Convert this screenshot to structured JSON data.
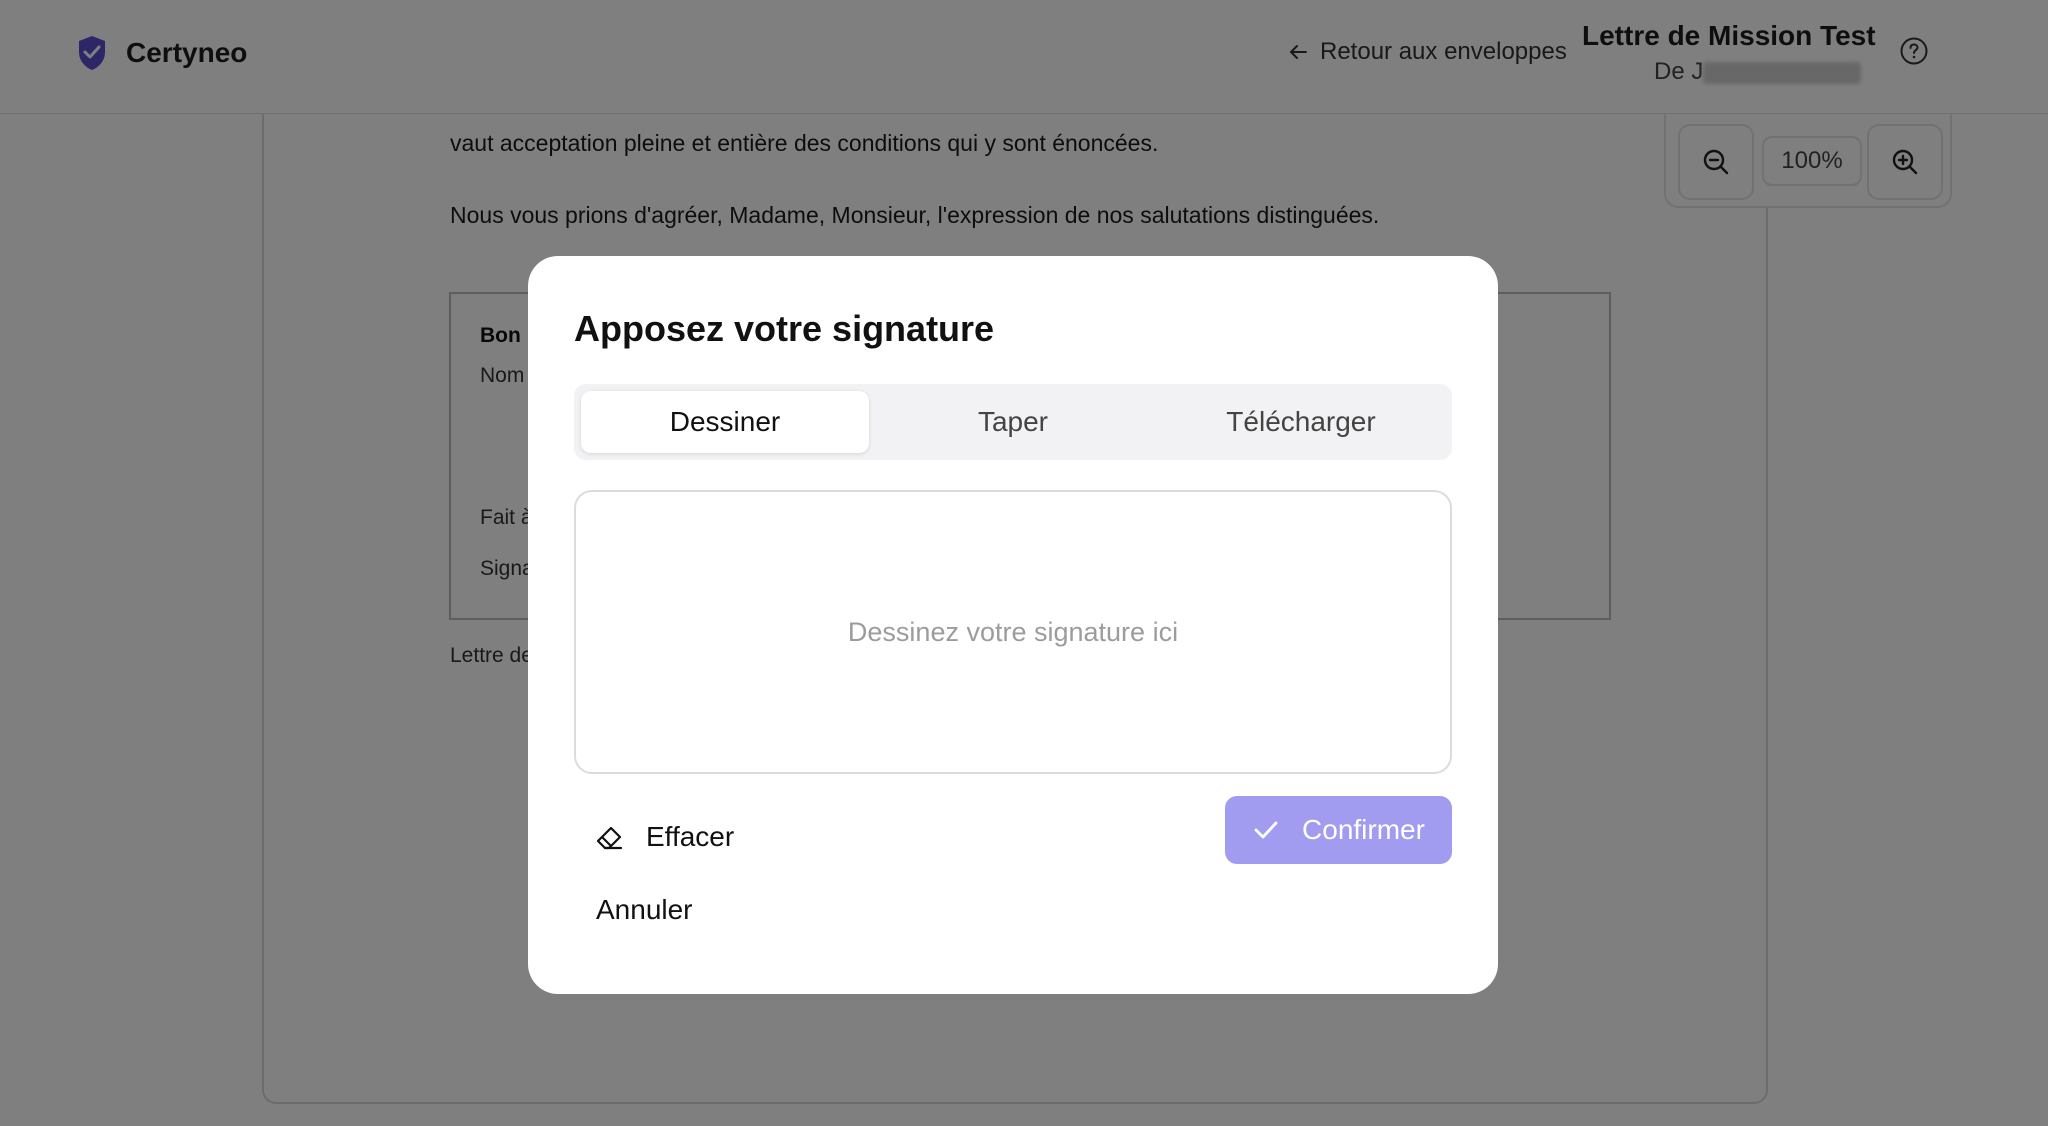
{
  "brand": {
    "name": "Certyneo",
    "logo_icon": "shield-check-icon",
    "accent": "#5a4fcf"
  },
  "header": {
    "back_label": "Retour aux enveloppes",
    "doc_title": "Lettre de Mission Test",
    "doc_from_prefix": "De J"
  },
  "zoom": {
    "level": "100%"
  },
  "document": {
    "para1": "vaut acceptation pleine et entière des conditions qui y sont énoncées.",
    "para2": "Nous vous prions d'agréer, Madame, Monsieur, l'expression de nos salutations distinguées.",
    "box_title": "Bon",
    "box_name": "Nom",
    "box_done": "Fait à",
    "box_sign": "Signa",
    "footer": "Lettre de"
  },
  "modal": {
    "title": "Apposez votre signature",
    "tabs": [
      {
        "label": "Dessiner",
        "active": true
      },
      {
        "label": "Taper",
        "active": false
      },
      {
        "label": "Télécharger",
        "active": false
      }
    ],
    "placeholder": "Dessinez votre signature ici",
    "clear_label": "Effacer",
    "confirm_label": "Confirmer",
    "cancel_label": "Annuler",
    "confirm_color": "#a19cf0"
  }
}
